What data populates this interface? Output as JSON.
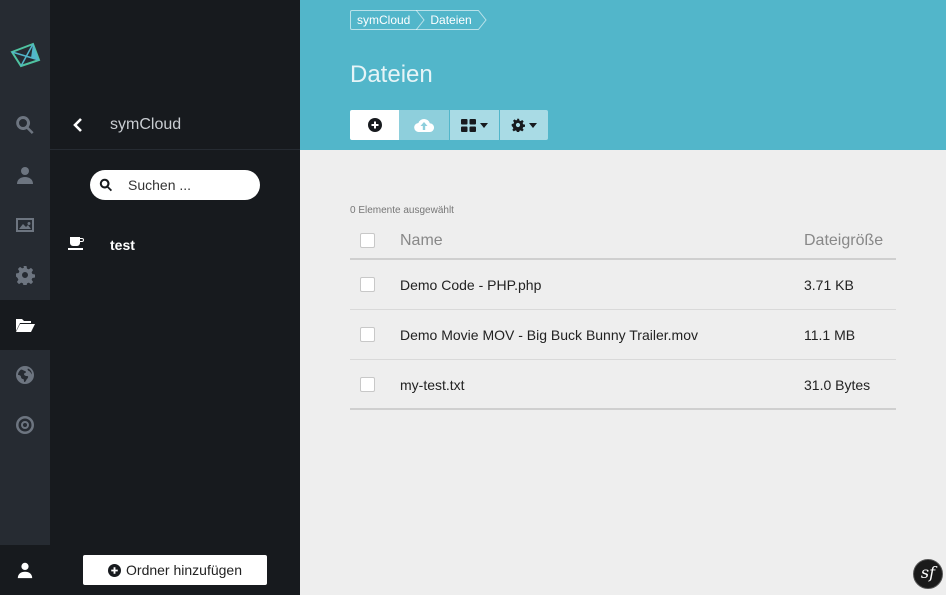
{
  "rail": {
    "items": [
      {
        "name": "search-icon",
        "active": false
      },
      {
        "name": "user-icon",
        "active": false
      },
      {
        "name": "image-icon",
        "active": false
      },
      {
        "name": "gear-icon",
        "active": false
      },
      {
        "name": "folder-open-icon",
        "active": true
      },
      {
        "name": "globe-icon",
        "active": false
      },
      {
        "name": "target-icon",
        "active": false
      }
    ],
    "bottom_icon": "user-icon"
  },
  "nav": {
    "title": "symCloud",
    "search": {
      "placeholder": "Suchen ..."
    },
    "items": [
      {
        "label": "test",
        "icon": "coffee-cup-icon"
      }
    ],
    "add_folder_label": "Ordner hinzufügen"
  },
  "header": {
    "breadcrumbs": [
      "symCloud",
      "Dateien"
    ],
    "title": "Dateien",
    "toolbar": [
      "add-icon",
      "cloud-upload-icon",
      "grid-view-icon",
      "gear-icon"
    ]
  },
  "content": {
    "selection_count": "0 Elemente ausgewählt",
    "columns": {
      "name": "Name",
      "size": "Dateigröße"
    },
    "rows": [
      {
        "name": "Demo Code - PHP.php",
        "size": "3.71 KB"
      },
      {
        "name": "Demo Movie MOV - Big Buck Bunny Trailer.mov",
        "size": "11.1 MB"
      },
      {
        "name": "my-test.txt",
        "size": "31.0 Bytes"
      }
    ]
  },
  "debug_badge": "sf",
  "colors": {
    "accent": "#52b6ca",
    "sidebar": "#171a1e",
    "rail": "#262b32",
    "content_bg": "#eeeeee"
  }
}
